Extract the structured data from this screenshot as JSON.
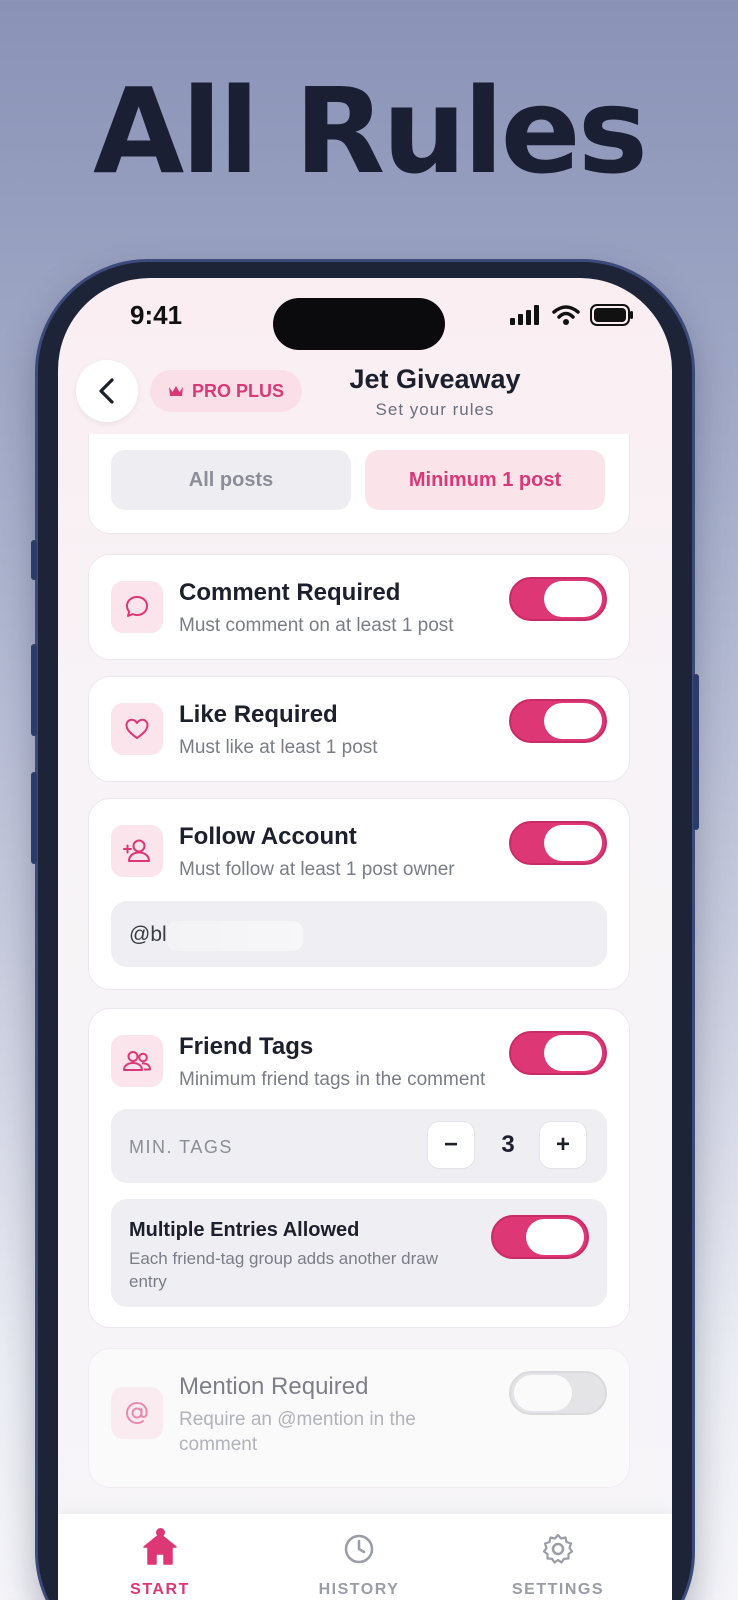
{
  "headline": "All Rules",
  "status_bar": {
    "time": "9:41"
  },
  "header": {
    "badge": "PRO PLUS",
    "title": "Jet Giveaway",
    "subtitle": "Set your rules"
  },
  "post_scope": {
    "options": [
      "All posts",
      "Minimum 1 post"
    ],
    "selected": "Minimum 1 post"
  },
  "rules": [
    {
      "title": "Comment Required",
      "description": "Must comment on at least 1 post",
      "enabled": true
    },
    {
      "title": "Like Required",
      "description": "Must like at least 1 post",
      "enabled": true
    },
    {
      "title": "Follow Account",
      "description": "Must follow at least 1 post owner",
      "enabled": true,
      "handle": "@bl"
    },
    {
      "title": "Friend Tags",
      "description": "Minimum friend tags in the comment",
      "enabled": true
    },
    {
      "title": "Mention Required",
      "description": "Require an @mention in the comment",
      "enabled": false
    }
  ],
  "friend_tags": {
    "min_label": "MIN. TAGS",
    "minus": "−",
    "value": "3",
    "plus": "+",
    "multiple_entries": {
      "title": "Multiple Entries Allowed",
      "description": "Each friend-tag group adds another draw entry",
      "enabled": true
    }
  },
  "nav": [
    {
      "label": "START",
      "icon": "home-icon",
      "active": true
    },
    {
      "label": "HISTORY",
      "icon": "clock-icon",
      "active": false
    },
    {
      "label": "SETTINGS",
      "icon": "gear-icon",
      "active": false
    }
  ],
  "colors": {
    "accent": "#de3775",
    "accent_soft": "#fbe3ea"
  }
}
